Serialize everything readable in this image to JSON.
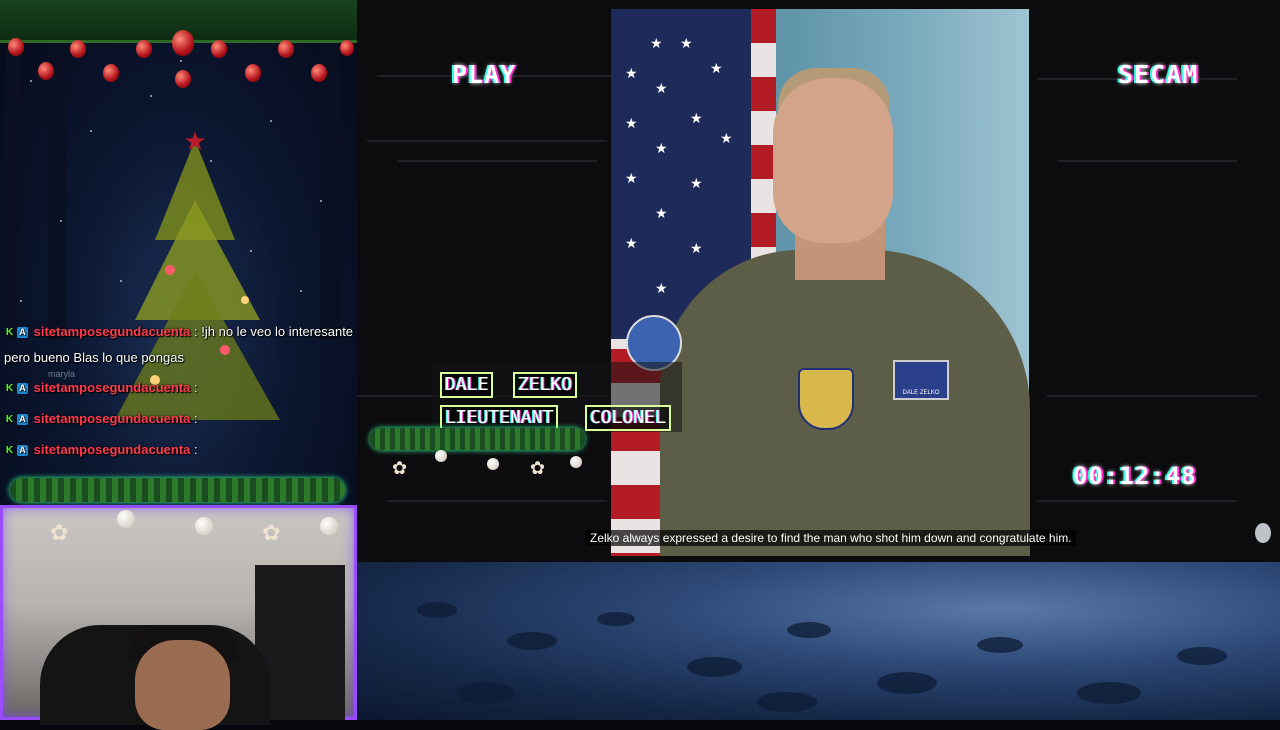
{
  "chat": {
    "messages": [
      {
        "badge_k": "K",
        "badge_a": "A",
        "user": "sitetamposegundacuenta",
        "sep": ":",
        "text": "!jh no le veo lo interesante"
      },
      {
        "badge_k": "",
        "badge_a": "",
        "user": "",
        "sep": "",
        "text": "pero bueno Blas lo que pongas"
      },
      {
        "badge_k": "K",
        "badge_a": "A",
        "user": "sitetamposegundacuenta",
        "sep": ":",
        "text": ""
      },
      {
        "badge_k": "K",
        "badge_a": "A",
        "user": "sitetamposegundacuenta",
        "sep": ":",
        "text": ""
      },
      {
        "badge_k": "K",
        "badge_a": "A",
        "user": "sitetamposegundacuenta",
        "sep": ":",
        "text": ""
      }
    ],
    "faint_name": "maryla"
  },
  "video": {
    "play_label": "PLAY",
    "format_label": "SECAM",
    "timecode": "00:12:48",
    "name_first": "DALE",
    "name_last": "ZELKO",
    "rank_1": "LIEUTENANT",
    "rank_2": "COLONEL",
    "subtitle": "Zelko always expressed a desire to find the man who shot him down and congratulate him.",
    "name_patch": "DALE ZELKO"
  },
  "icons": {
    "kick_badge": "kick-badge-icon",
    "verified_badge": "verified-badge-icon",
    "settings": "record-indicator-icon"
  },
  "colors": {
    "chat_user": "#ff3b4d",
    "kick_green": "#53fc18",
    "webcam_border": "#9a4cff",
    "garland_glow": "#39ff98"
  }
}
